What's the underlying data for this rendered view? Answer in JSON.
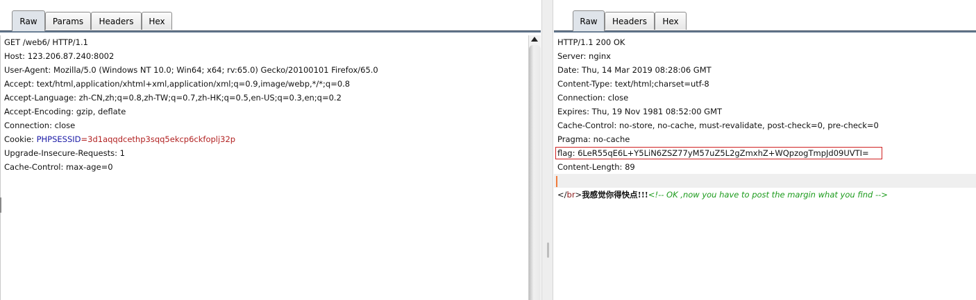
{
  "request": {
    "tabs": [
      {
        "label": "Raw",
        "active": true
      },
      {
        "label": "Params",
        "active": false
      },
      {
        "label": "Headers",
        "active": false
      },
      {
        "label": "Hex",
        "active": false
      }
    ],
    "lines": [
      "GET /web6/ HTTP/1.1",
      "Host: 123.206.87.240:8002",
      "User-Agent: Mozilla/5.0 (Windows NT 10.0; Win64; x64; rv:65.0) Gecko/20100101 Firefox/65.0",
      "Accept: text/html,application/xhtml+xml,application/xml;q=0.9,image/webp,*/*;q=0.8",
      "Accept-Language: zh-CN,zh;q=0.8,zh-TW;q=0.7,zh-HK;q=0.5,en-US;q=0.3,en;q=0.2",
      "Accept-Encoding: gzip, deflate",
      "Connection: close"
    ],
    "cookie": {
      "prefix": "Cookie: ",
      "name": "PHPSESSID",
      "equals": "=",
      "value": "3d1aqqdcethp3sqq5ekcp6ckfoplj32p"
    },
    "lines_after": [
      "Upgrade-Insecure-Requests: 1",
      "Cache-Control: max-age=0"
    ]
  },
  "response": {
    "tabs": [
      {
        "label": "Raw",
        "active": true
      },
      {
        "label": "Headers",
        "active": false
      },
      {
        "label": "Hex",
        "active": false
      }
    ],
    "lines": [
      "HTTP/1.1 200 OK",
      "Server: nginx",
      "Date: Thu, 14 Mar 2019 08:28:06 GMT",
      "Content-Type: text/html;charset=utf-8",
      "Connection: close",
      "Expires: Thu, 19 Nov 1981 08:52:00 GMT",
      "Cache-Control: no-store, no-cache, must-revalidate, post-check=0, pre-check=0",
      "Pragma: no-cache"
    ],
    "flag_line": "flag: 6LeR55qE6L+Y5LiN6ZSZ77yM57uZ5L2gZmxhZ+WQpzogTmpJd09UVTI=",
    "content_length": "Content-Length: 89",
    "body": {
      "open": "</",
      "tag": "br",
      "close": ">",
      "chinese": "我感觉你得快点!!!",
      "comment": "<!-- OK ,now you have to post the margin what you find -->"
    }
  },
  "colors": {
    "accent_orange": "#f07a3a",
    "flag_border": "#d02020",
    "cookie_name": "#1a1aa6",
    "cookie_value": "#b22222",
    "comment_green": "#1a9a1a"
  }
}
